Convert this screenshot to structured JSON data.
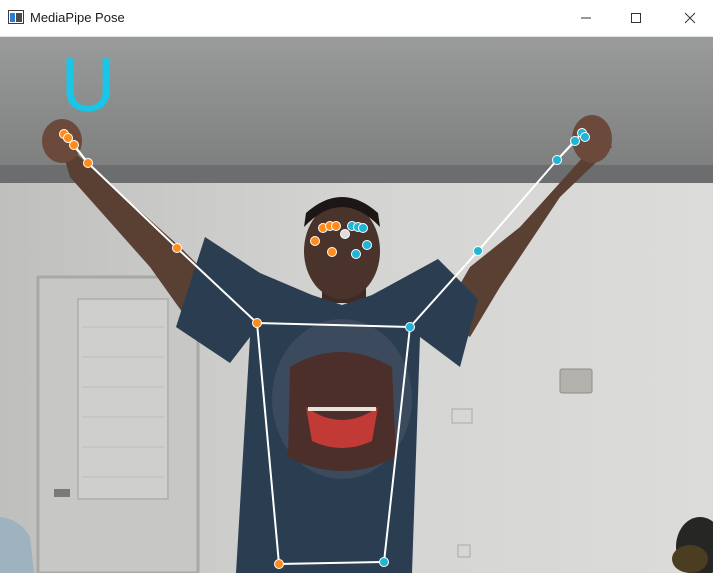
{
  "window": {
    "title": "MediaPipe Pose",
    "icon": "app-window-icon",
    "controls": [
      "minimize-icon",
      "maximize-icon",
      "close-icon"
    ]
  },
  "overlay": {
    "gesture_label": "U",
    "gesture_color": "#19c6e8",
    "left_side_color": "#ff8c1a",
    "right_side_color": "#1fb5d6",
    "center_point_color": "#dcdcdc",
    "connection_color": "#ffffff"
  }
}
